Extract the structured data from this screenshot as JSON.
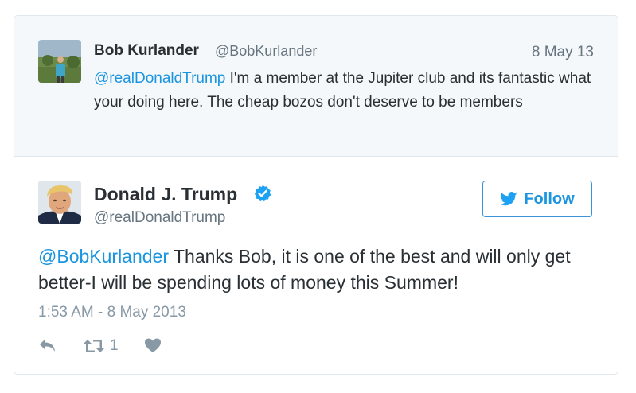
{
  "parent_tweet": {
    "author_name": "Bob Kurlander",
    "author_handle": "@BobKurlander",
    "date": "8 May 13",
    "mention": "@realDonaldTrump",
    "text": " I'm a member at the Jupiter club and its fantastic what your doing here. The cheap bozos don't deserve to be members"
  },
  "main_tweet": {
    "author_name": "Donald J. Trump",
    "author_handle": "@realDonaldTrump",
    "verified": true,
    "follow_label": "Follow",
    "mention": "@BobKurlander",
    "text": " Thanks Bob, it is one of the best and will only get better-I will be spending lots of money this Summer!",
    "timestamp": "1:53 AM - 8 May 2013",
    "retweet_count": "1"
  },
  "icons": {
    "verified": "verified-badge-icon",
    "follow": "twitter-bird-icon",
    "reply": "reply-icon",
    "retweet": "retweet-icon",
    "like": "heart-icon"
  },
  "colors": {
    "link": "#1b95e0",
    "verified": "#1da1f2",
    "muted": "#8899a6",
    "parent_bg": "#f5f8fa"
  }
}
